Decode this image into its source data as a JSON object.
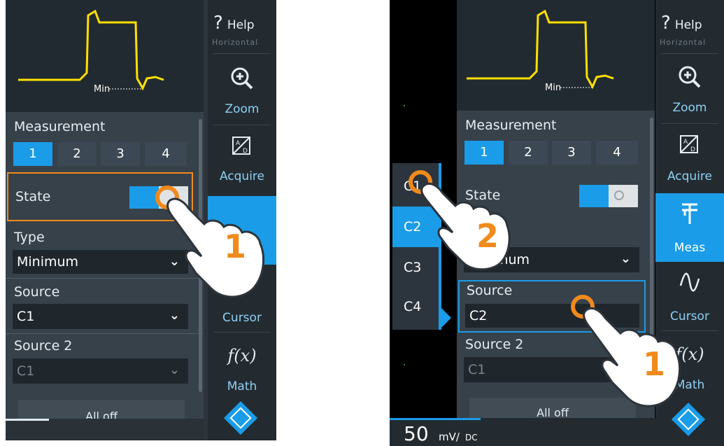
{
  "colors": {
    "accent": "#1a9ce8",
    "highlight": "#f08a1c",
    "waveform": "#ffe000"
  },
  "panel": {
    "help_label": "Help",
    "horizontal_label": "Horizontal",
    "min_marker": "Min",
    "measurement_label": "Measurement",
    "measurement_tabs": [
      "1",
      "2",
      "3",
      "4"
    ],
    "measurement_selected": "1",
    "state_label": "State",
    "type_label": "Type",
    "type_value": "Minimum",
    "source_label": "Source",
    "source2_label": "Source 2",
    "all_off_label": "All off"
  },
  "left": {
    "source_value": "C1",
    "source2_value": "C1",
    "step": "1"
  },
  "right": {
    "source_value": "C2",
    "source2_value": "C1",
    "channel_options": [
      "C1",
      "C2",
      "C3",
      "C4"
    ],
    "channel_selected": "C2",
    "step1": "1",
    "step2": "2",
    "scale_value": "50",
    "scale_unit": "mV/",
    "coupling": "DC"
  },
  "sidebar": {
    "zoom_label": "Zoom",
    "acquire_label": "Acquire",
    "meas_label": "Meas",
    "cursor_label": "Cursor",
    "math_label": "Math",
    "icons": [
      "zoom-icon",
      "acquire-icon",
      "meas-icon",
      "cursor-icon",
      "math-icon",
      "logo-icon"
    ]
  }
}
